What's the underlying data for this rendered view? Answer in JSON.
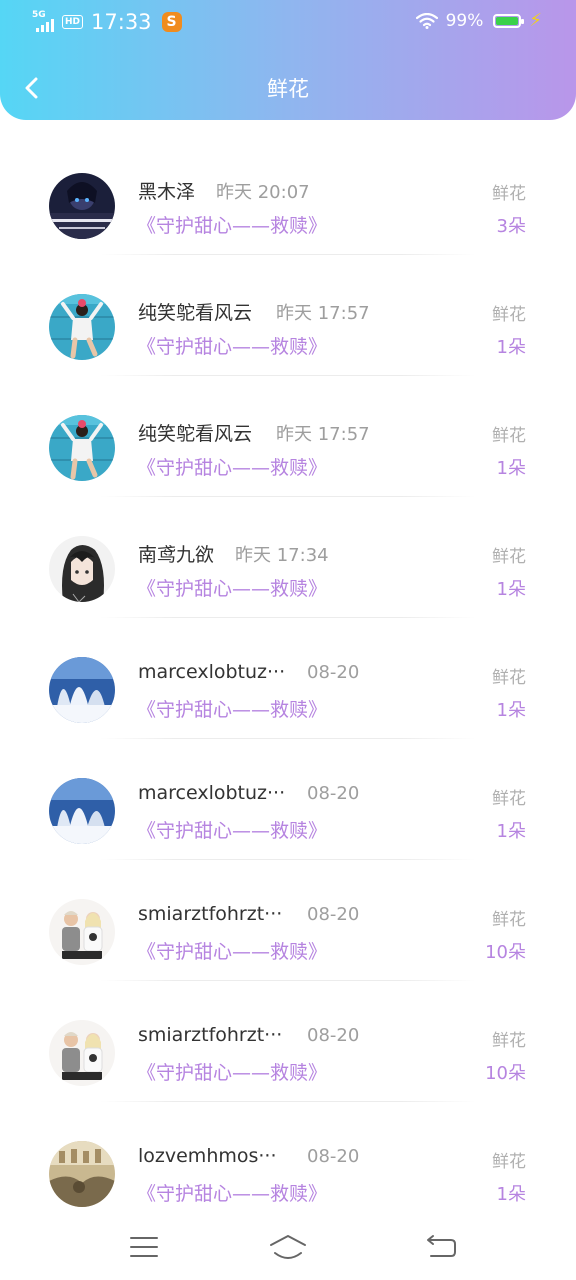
{
  "status_bar": {
    "network": "5G",
    "hd": "HD",
    "time": "17:33",
    "app_icon": "S",
    "battery_percent": "99%",
    "battery_level": 0.99
  },
  "header": {
    "title": "鲜花",
    "back_icon": "chevron-left-icon",
    "gradient": [
      "#55d6f5",
      "#b996ea"
    ]
  },
  "colors": {
    "accent": "#b684e0",
    "name": "#333333",
    "muted": "#9e9e9e"
  },
  "items": [
    {
      "name": "黑木泽",
      "time": "昨天 20:07",
      "gift": "《守护甜心——救赎》",
      "label": "鲜花",
      "count": "3朵",
      "avatar": "dark-anime-avatar"
    },
    {
      "name": "纯笑鸵看风云",
      "time": "昨天 17:57",
      "gift": "《守护甜心——救赎》",
      "label": "鲜花",
      "count": "1朵",
      "avatar": "blue-wall-avatar"
    },
    {
      "name": "纯笑鸵看风云",
      "time": "昨天 17:57",
      "gift": "《守护甜心——救赎》",
      "label": "鲜花",
      "count": "1朵",
      "avatar": "blue-wall-avatar"
    },
    {
      "name": "南鸢九欲",
      "time": "昨天 17:34",
      "gift": "《守护甜心——救赎》",
      "label": "鲜花",
      "count": "1朵",
      "avatar": "anime-girl-avatar"
    },
    {
      "name": "marcexlobtuz···",
      "time": "08-20",
      "gift": "《守护甜心——救赎》",
      "label": "鲜花",
      "count": "1朵",
      "avatar": "snow-forest-avatar"
    },
    {
      "name": "marcexlobtuz···",
      "time": "08-20",
      "gift": "《守护甜心——救赎》",
      "label": "鲜花",
      "count": "1朵",
      "avatar": "snow-forest-avatar"
    },
    {
      "name": "smiarztfohrzt···",
      "time": "08-20",
      "gift": "《守护甜心——救赎》",
      "label": "鲜花",
      "count": "10朵",
      "avatar": "couple-avatar"
    },
    {
      "name": "smiarztfohrzt···",
      "time": "08-20",
      "gift": "《守护甜心——救赎》",
      "label": "鲜花",
      "count": "10朵",
      "avatar": "couple-avatar"
    },
    {
      "name": "lozvemhmos···",
      "time": "08-20",
      "gift": "《守护甜心——救赎》",
      "label": "鲜花",
      "count": "1朵",
      "avatar": "sepia-room-avatar"
    }
  ],
  "navbar": {
    "menu_icon": "menu-icon",
    "home_icon": "home-icon",
    "back_icon": "back-icon"
  }
}
